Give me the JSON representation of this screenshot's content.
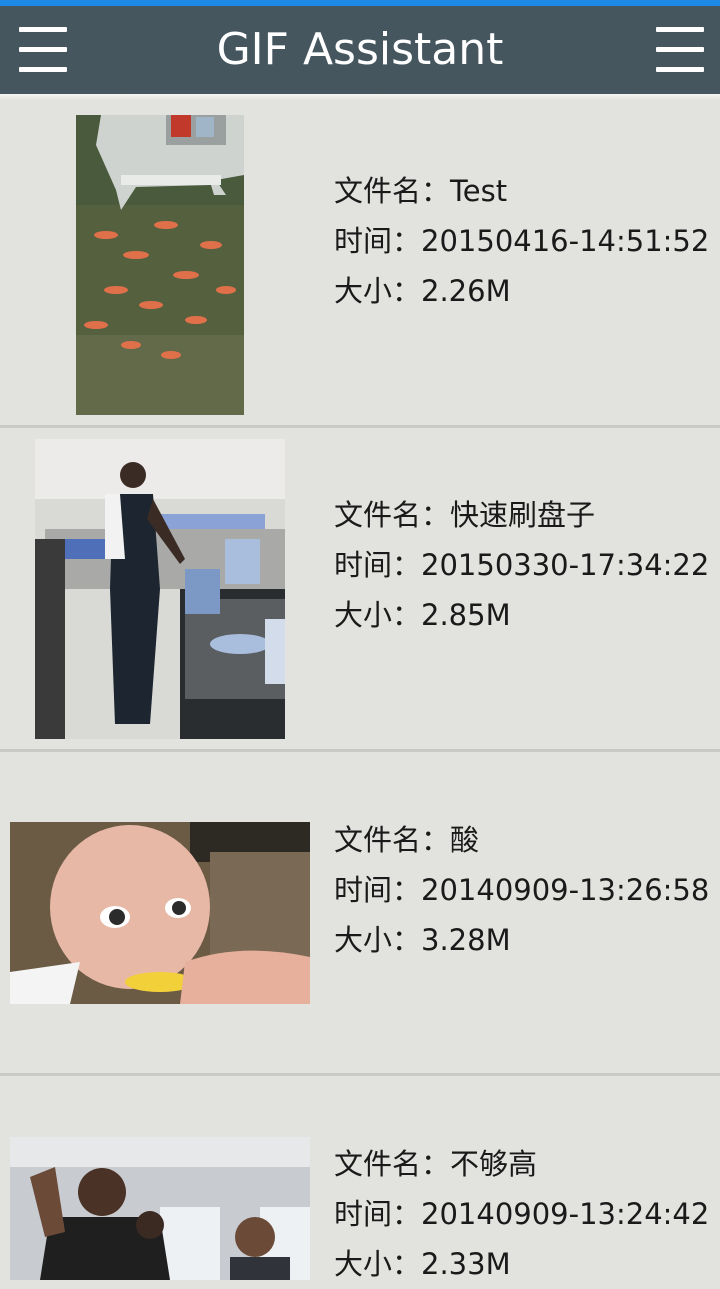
{
  "app": {
    "title": "GIF Assistant"
  },
  "labels": {
    "name": "文件名：",
    "time": "时间：",
    "size": "大小："
  },
  "items": [
    {
      "name": "Test",
      "time": "20150416-14:51:52",
      "size": "2.26M",
      "thumb": "fish pond gif thumbnail"
    },
    {
      "name": "快速刷盘子",
      "time": "20150330-17:34:22",
      "size": "2.85M",
      "thumb": "dishwasher gif thumbnail"
    },
    {
      "name": "酸",
      "time": "20140909-13:26:58",
      "size": "3.28M",
      "thumb": "baby lemon gif thumbnail"
    },
    {
      "name": "不够高",
      "time": "20140909-13:24:42",
      "size": "2.33M",
      "thumb": "train passengers gif thumbnail"
    }
  ],
  "colors": {
    "status_bar": "#1e88e5",
    "app_bar": "#45565f",
    "background": "#e2e2df",
    "divider": "#c9c9c6"
  }
}
